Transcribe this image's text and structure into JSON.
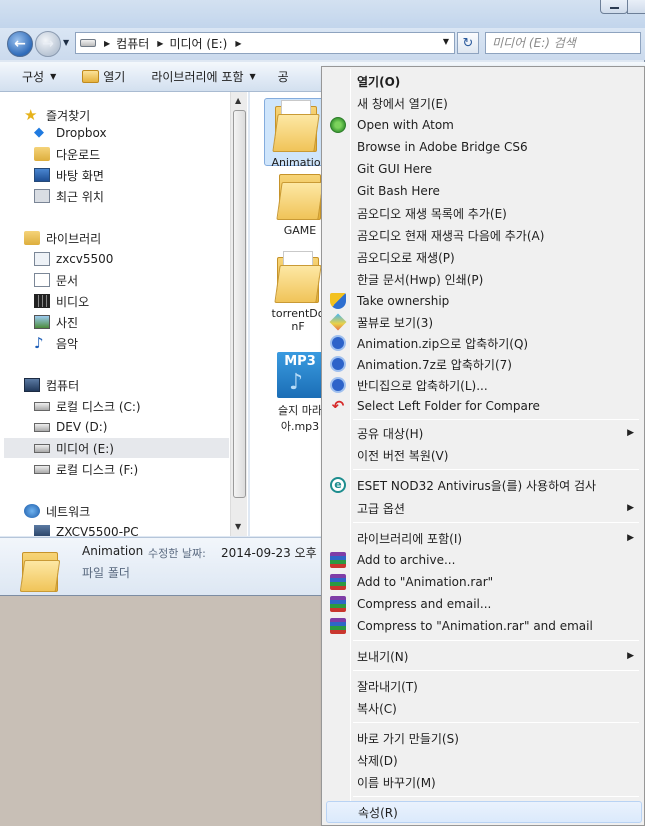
{
  "explorer": {
    "breadcrumb": [
      "컴퓨터",
      "미디어 (E:)"
    ],
    "search_placeholder": "미디어 (E:) 검색",
    "toolbar": {
      "organize": "구성",
      "open": "열기",
      "include_in_library": "라이브러리에 포함",
      "share_partial": "공"
    },
    "nav": {
      "favorites_header": "즐겨찾기",
      "favorites": [
        "Dropbox",
        "다운로드",
        "바탕 화면",
        "최근 위치"
      ],
      "libraries_header": "라이브러리",
      "libraries": [
        "zxcv5500",
        "문서",
        "비디오",
        "사진",
        "음악"
      ],
      "computer_header": "컴퓨터",
      "drives": [
        "로컬 디스크 (C:)",
        "DEV (D:)",
        "미디어 (E:)",
        "로컬 디스크 (F:)"
      ],
      "selected_drive": "미디어 (E:)",
      "network_header": "네트워크",
      "network_items": [
        "ZXCV5500-PC"
      ]
    },
    "files": [
      {
        "line1": "Animatio",
        "line2": "",
        "type": "folder",
        "selected": true
      },
      {
        "line1": "GAME",
        "line2": "",
        "type": "folder"
      },
      {
        "line1": "torrentDo",
        "line2": "nF",
        "type": "folder"
      },
      {
        "line1": "슬지 마라",
        "line2": "아.mp3",
        "type": "mp3",
        "icon_text": "MP3"
      }
    ],
    "details": {
      "name": "Animation",
      "modified_label": "수정한 날짜:",
      "modified_value": "2014-09-23 오후 !",
      "type": "파일 폴더"
    }
  },
  "context_menu": {
    "items": [
      {
        "label": "열기(O)",
        "bold": true
      },
      {
        "label": "새 창에서 열기(E)"
      },
      {
        "label": "Open with Atom",
        "icon": "atom-icon"
      },
      {
        "label": "Browse in Adobe Bridge CS6"
      },
      {
        "label": "Git GUI Here"
      },
      {
        "label": "Git Bash Here"
      },
      {
        "label": "곰오디오 재생 목록에 추가(E)"
      },
      {
        "label": "곰오디오 현재 재생곡 다음에 추가(A)"
      },
      {
        "label": "곰오디오로 재생(P)"
      },
      {
        "label": "한글 문서(Hwp) 인쇄(P)"
      },
      {
        "label": "Take ownership",
        "icon": "uac-shield-icon"
      },
      {
        "label": "꿀뷰로 보기(3)",
        "icon": "honeyview-icon"
      },
      {
        "label": "Animation.zip으로 압축하기(Q)",
        "icon": "bandizip-icon"
      },
      {
        "label": "Animation.7z로 압축하기(7)",
        "icon": "bandizip-icon"
      },
      {
        "label": "반디집으로 압축하기(L)...",
        "icon": "bandizip-icon"
      },
      {
        "label": "Select Left Folder for Compare",
        "icon": "compare-icon"
      },
      {
        "label": "공유 대상(H)",
        "submenu": true
      },
      {
        "label": "이전 버전 복원(V)"
      },
      {
        "label": "ESET NOD32 Antivirus을(를) 사용하여 검사",
        "icon": "eset-icon",
        "icon_text": "e"
      },
      {
        "label": "고급 옵션",
        "submenu": true
      },
      {
        "label": "라이브러리에 포함(I)",
        "submenu": true
      },
      {
        "label": "Add to archive...",
        "icon": "winrar-icon"
      },
      {
        "label": "Add to \"Animation.rar\"",
        "icon": "winrar-icon"
      },
      {
        "label": "Compress and email...",
        "icon": "winrar-icon"
      },
      {
        "label": "Compress to \"Animation.rar\" and email",
        "icon": "winrar-icon"
      },
      {
        "label": "보내기(N)",
        "submenu": true
      },
      {
        "label": "잘라내기(T)"
      },
      {
        "label": "복사(C)"
      },
      {
        "label": "바로 가기 만들기(S)"
      },
      {
        "label": "삭제(D)"
      },
      {
        "label": "이름 바꾸기(M)"
      },
      {
        "label": "속성(R)",
        "hovered": true
      }
    ]
  }
}
